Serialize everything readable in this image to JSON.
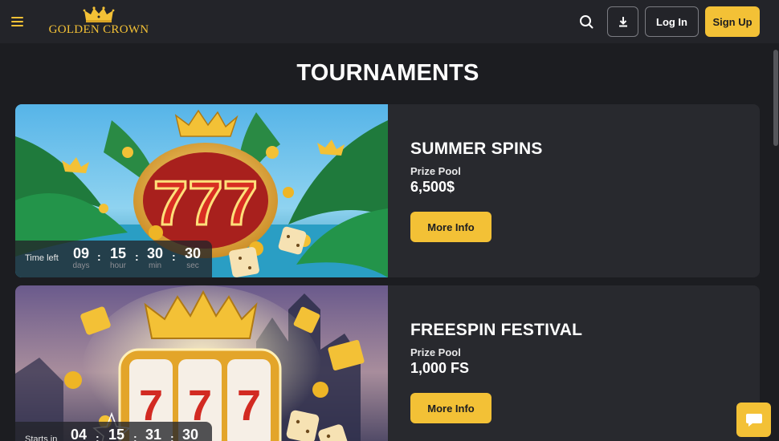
{
  "header": {
    "logo_text": "GOLDEN CROWN",
    "login_label": "Log In",
    "signup_label": "Sign Up"
  },
  "page": {
    "title": "TOURNAMENTS"
  },
  "tournaments": [
    {
      "title": "SUMMER SPINS",
      "prize_label": "Prize Pool",
      "prize_value": "6,500$",
      "button_label": "More Info",
      "timer": {
        "label": "Time left",
        "days": "09",
        "days_label": "days",
        "hours": "15",
        "hours_label": "hour",
        "minutes": "30",
        "minutes_label": "min",
        "seconds": "30",
        "seconds_label": "sec"
      }
    },
    {
      "title": "FREESPIN FESTIVAL",
      "prize_label": "Prize Pool",
      "prize_value": "1,000 FS",
      "button_label": "More Info",
      "timer": {
        "label": "Starts in",
        "days": "04",
        "hours": "15",
        "minutes": "31",
        "seconds": "30"
      }
    }
  ],
  "colors": {
    "accent": "#f3c136",
    "background": "#1c1d21",
    "card": "#28292e",
    "header": "#232429"
  },
  "icons": {
    "menu": "menu-icon",
    "logo": "crown-icon",
    "search": "search-icon",
    "download": "download-icon",
    "chat": "chat-icon"
  }
}
